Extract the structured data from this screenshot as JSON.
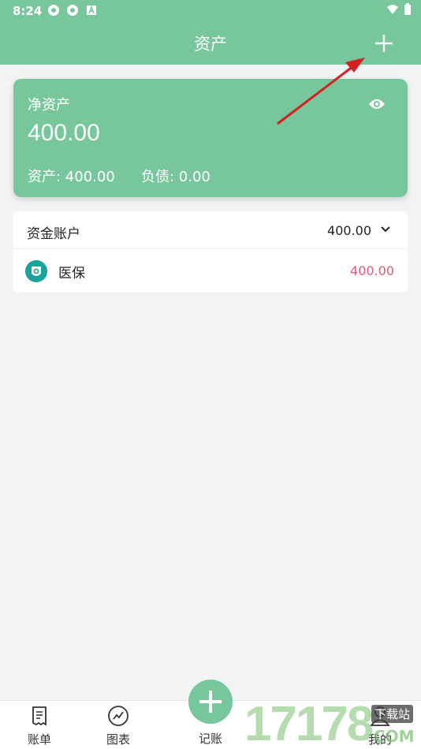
{
  "status_bar": {
    "time": "8:24"
  },
  "header": {
    "title": "资产"
  },
  "net_assets": {
    "label": "净资产",
    "value": "400.00",
    "assets_text": "资产: 400.00",
    "liabilities_text": "负债: 0.00"
  },
  "accounts": {
    "title": "资金账户",
    "total": "400.00",
    "items": [
      {
        "name": "医保",
        "amount": "400.00"
      }
    ]
  },
  "bottom_nav": {
    "bills": "账单",
    "charts": "图表",
    "record": "记账",
    "me": "我的"
  },
  "watermark": {
    "digits": "17178",
    "tag": "下载站",
    "suffix": "COM"
  },
  "colors": {
    "brand": "#78c79c",
    "amount_red": "#e05a7a",
    "account_icon": "#1aa39a",
    "arrow": "#d42020"
  }
}
